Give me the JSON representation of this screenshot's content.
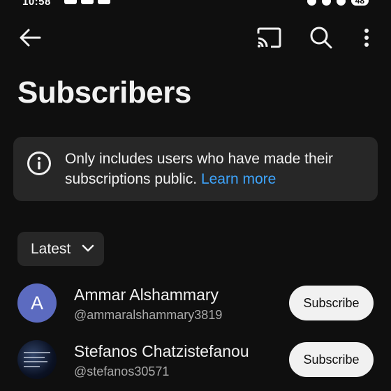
{
  "status_bar": {
    "time": "10:58",
    "battery": "48"
  },
  "header": {
    "title": "Subscribers",
    "icons": [
      "back-arrow-icon",
      "cast-icon",
      "search-icon",
      "more-vert-icon"
    ]
  },
  "info_card": {
    "icon": "info-icon",
    "text": "Only includes users who have made their subscriptions public.",
    "link_label": "Learn more",
    "link_color": "#3ea6ff"
  },
  "sort": {
    "label": "Latest"
  },
  "subscribers": [
    {
      "avatar_letter": "A",
      "avatar_color": "#5c6bc0",
      "name": "Ammar Alshammary",
      "handle": "@ammaralshammary3819",
      "button_label": "Subscribe"
    },
    {
      "avatar_letter": "",
      "name": "Stefanos Chatzistefanou",
      "handle": "@stefanos30571",
      "button_label": "Subscribe"
    }
  ],
  "colors": {
    "background": "#0f0f0f",
    "card": "#272727",
    "accent_link": "#3ea6ff"
  }
}
